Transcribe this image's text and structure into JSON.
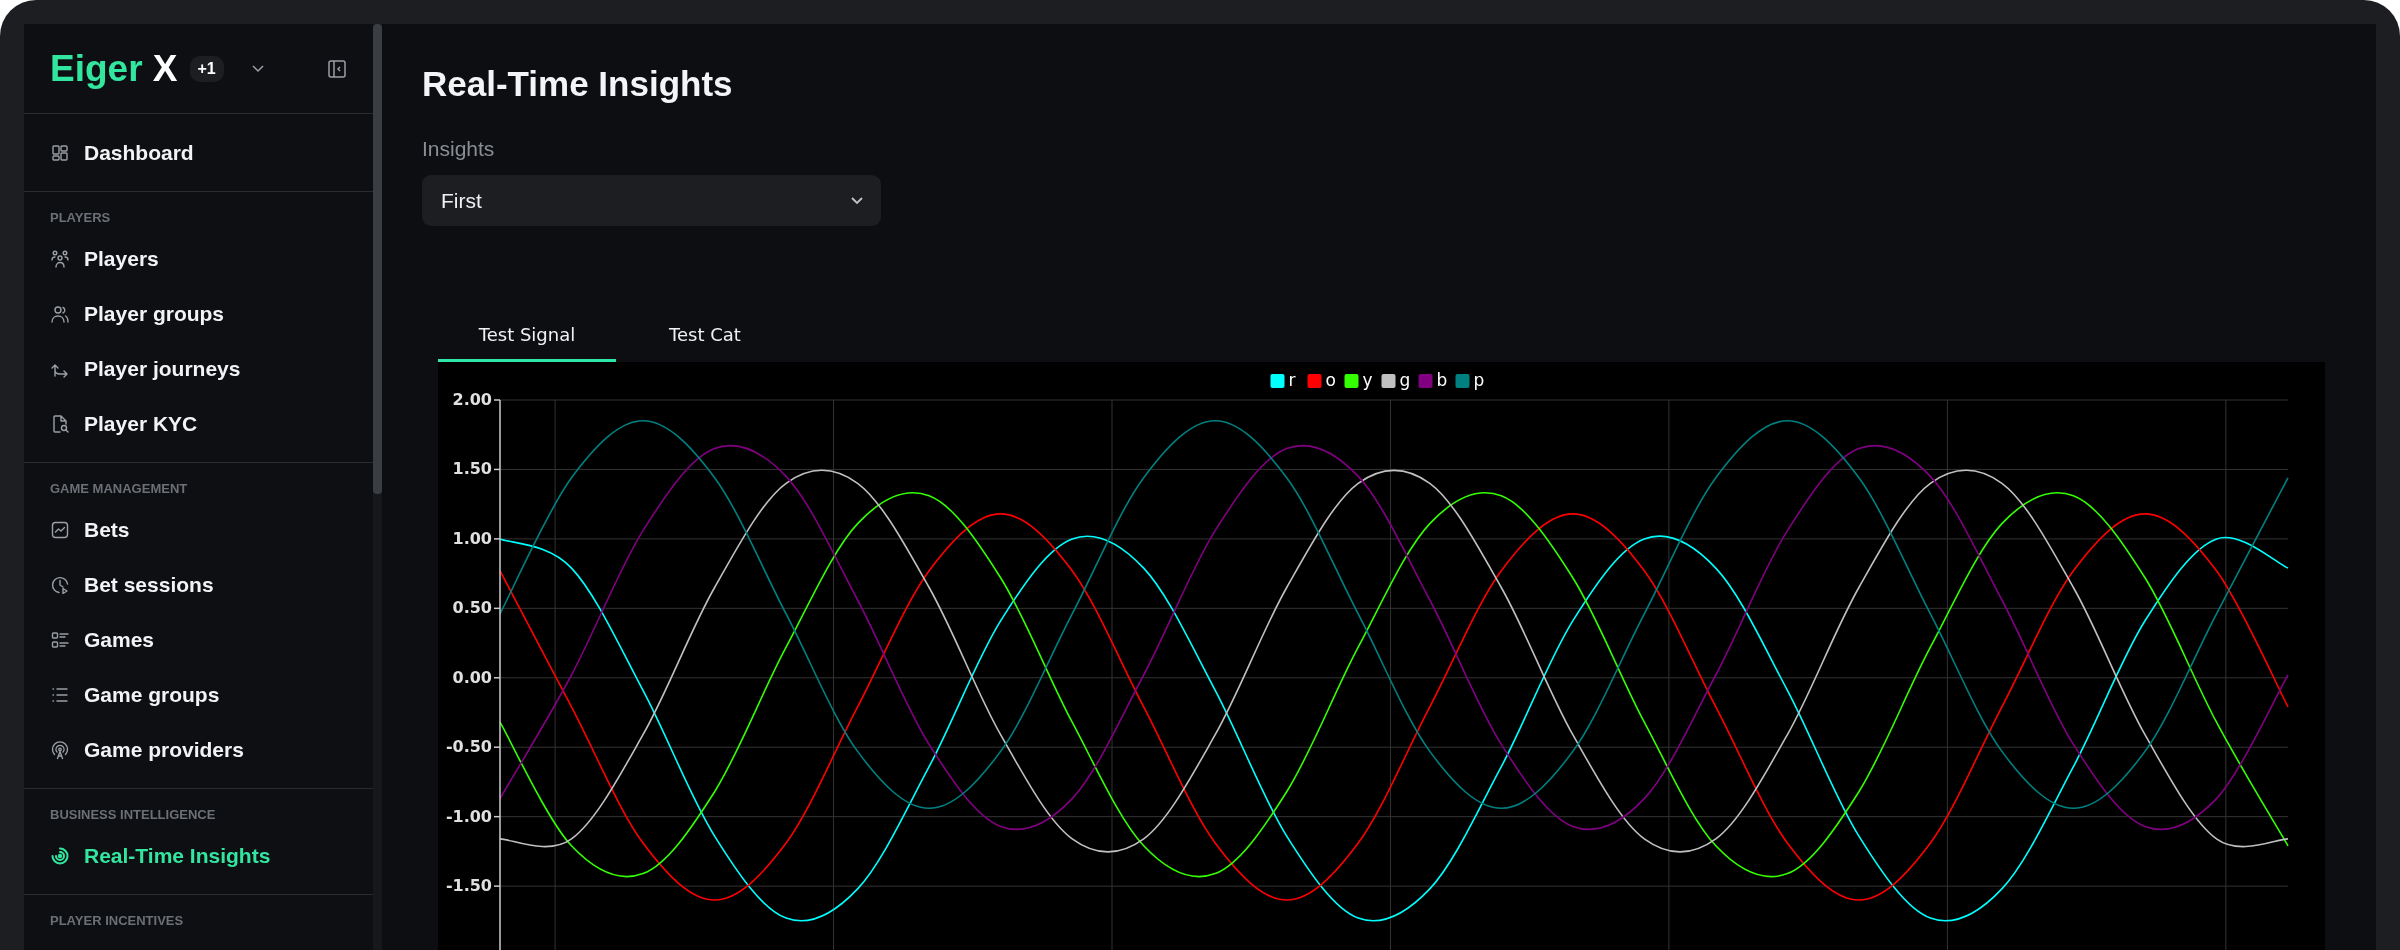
{
  "sidebar": {
    "logo": {
      "brand": "Eiger",
      "mark": "X",
      "badge": "+1"
    },
    "sections": [
      {
        "items": [
          {
            "label": "Dashboard",
            "selected": false
          }
        ]
      },
      {
        "title": "PLAYERS",
        "items": [
          {
            "label": "Players",
            "selected": false
          },
          {
            "label": "Player groups",
            "selected": false
          },
          {
            "label": "Player journeys",
            "selected": false
          },
          {
            "label": "Player KYC",
            "selected": false
          }
        ]
      },
      {
        "title": "GAME MANAGEMENT",
        "items": [
          {
            "label": "Bets",
            "selected": false
          },
          {
            "label": "Bet sessions",
            "selected": false
          },
          {
            "label": "Games",
            "selected": false
          },
          {
            "label": "Game groups",
            "selected": false
          },
          {
            "label": "Game providers",
            "selected": false
          }
        ]
      },
      {
        "title": "BUSINESS INTELLIGENCE",
        "items": [
          {
            "label": "Real-Time Insights",
            "selected": true
          }
        ]
      },
      {
        "title": "PLAYER INCENTIVES"
      }
    ]
  },
  "main": {
    "title": "Real-Time Insights",
    "select": {
      "label": "Insights",
      "value": "First"
    },
    "tabs": [
      {
        "label": "Test Signal",
        "selected": true
      },
      {
        "label": "Test Cat",
        "selected": false
      }
    ],
    "chart_data": {
      "type": "line",
      "grid": true,
      "legend": true,
      "ylim": [
        -1.96,
        2
      ],
      "yticks": [
        {
          "value": 2,
          "label": "2.00"
        },
        {
          "value": 1.5,
          "label": "1.50"
        },
        {
          "value": 1,
          "label": "1.00"
        },
        {
          "value": 0.5,
          "label": "0.50"
        },
        {
          "value": 0,
          "label": "0.00"
        },
        {
          "value": -0.5,
          "label": "-0.50"
        },
        {
          "value": -1,
          "label": "-1.00"
        },
        {
          "value": -1.5,
          "label": "-1.50"
        }
      ],
      "series": [
        {
          "name": "r",
          "color": "#00ffff",
          "values": [
            1.0,
            0.79,
            -0.09,
            -1.14,
            -1.73,
            -1.52,
            -0.64,
            0.41,
            1.0,
            0.79,
            -0.09,
            -1.14,
            -1.73,
            -1.52,
            -0.64,
            0.41,
            1.0,
            0.79,
            -0.09,
            -1.14,
            -1.73,
            -1.52,
            -0.64,
            0.41,
            1.0,
            0.79
          ]
        },
        {
          "name": "o",
          "color": "#ff0000",
          "values": [
            0.77,
            -0.21,
            -1.19,
            -1.6,
            -1.19,
            -0.21,
            0.77,
            1.18,
            0.77,
            -0.21,
            -1.19,
            -1.6,
            -1.19,
            -0.21,
            0.77,
            1.18,
            0.77,
            -0.21,
            -1.19,
            -1.6,
            -1.19,
            -0.21,
            0.77,
            1.18,
            0.77,
            -0.21
          ]
        },
        {
          "name": "y",
          "color": "#33ff00",
          "values": [
            -0.32,
            -1.21,
            -1.41,
            -0.82,
            0.22,
            1.11,
            1.31,
            0.72,
            -0.32,
            -1.21,
            -1.41,
            -0.82,
            0.22,
            1.11,
            1.31,
            0.72,
            -0.32,
            -1.21,
            -1.41,
            -0.82,
            0.22,
            1.11,
            1.31,
            0.72,
            -0.32,
            -1.21
          ]
        },
        {
          "name": "g",
          "color": "#c0c0c0",
          "values": [
            -1.16,
            -1.16,
            -0.41,
            0.65,
            1.4,
            1.4,
            0.65,
            -0.41,
            -1.16,
            -1.16,
            -0.41,
            0.65,
            1.4,
            1.4,
            0.65,
            -0.41,
            -1.16,
            -1.16,
            -0.41,
            0.65,
            1.4,
            1.4,
            0.65,
            -0.41,
            -1.16,
            -1.16
          ]
        },
        {
          "name": "b",
          "color": "#800080",
          "values": [
            -0.87,
            0.02,
            1.06,
            1.65,
            1.45,
            0.56,
            -0.48,
            -1.07,
            -0.87,
            0.02,
            1.06,
            1.65,
            1.45,
            0.56,
            -0.48,
            -1.07,
            -0.87,
            0.02,
            1.06,
            1.65,
            1.45,
            0.56,
            -0.48,
            -1.07,
            -0.87,
            0.02
          ]
        },
        {
          "name": "p",
          "color": "#008080",
          "values": [
            0.46,
            1.44,
            1.85,
            1.44,
            0.46,
            -0.53,
            -0.94,
            -0.53,
            0.46,
            1.44,
            1.85,
            1.44,
            0.46,
            -0.53,
            -0.94,
            -0.53,
            0.46,
            1.44,
            1.85,
            1.44,
            0.46,
            -0.53,
            -0.94,
            -0.53,
            0.46,
            1.44
          ]
        }
      ]
    }
  }
}
